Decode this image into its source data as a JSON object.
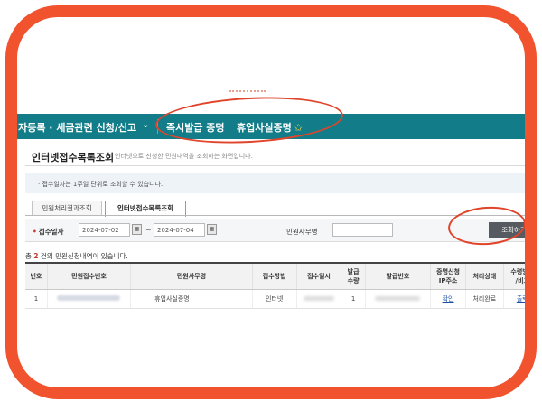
{
  "nav": {
    "item1": "업자등록 · 세금관련 신청/신고",
    "chevron": "⌄",
    "item2": "즉시발급 증명",
    "item3": "휴업사실증명",
    "star": "✩"
  },
  "page": {
    "title": "인터넷접수목록조회",
    "desc": "인터넷으로 신청한 민원내역을 조회하는 화면입니다."
  },
  "info": {
    "text": "· 접수일자는 1주일 단위로 조회할 수 있습니다."
  },
  "tabs": [
    "민원처리결과조회",
    "인터넷접수목록조회"
  ],
  "search": {
    "date_label": "접수일자",
    "date_dot": "•",
    "date_from": "2024-07-02",
    "date_to": "2024-07-04",
    "tilde": "~",
    "cal_icon": "▦",
    "type_label": "민원사무명",
    "type_value": "",
    "button": "조회하기"
  },
  "result": {
    "prefix": "총 ",
    "count": "2",
    "suffix": " 건의 민원신청내역이 있습니다."
  },
  "table": {
    "headers": [
      "번호",
      "민원접수번호",
      "민원사무명",
      "접수방법",
      "접수일시",
      "발급\n수량",
      "발급번호",
      "증명신청\nIP주소",
      "처리상태",
      "수령방법\n/비고"
    ],
    "rows": [
      {
        "no": "1",
        "office": "휴업사실증명",
        "method": "인터넷",
        "qty": "1",
        "ip": "확인",
        "status": "처리완료",
        "receive": "출력"
      }
    ]
  },
  "colors": {
    "nav": "#127d88",
    "frame": "#f2532f",
    "annotation": "#e0442b",
    "button": "#555b61"
  }
}
